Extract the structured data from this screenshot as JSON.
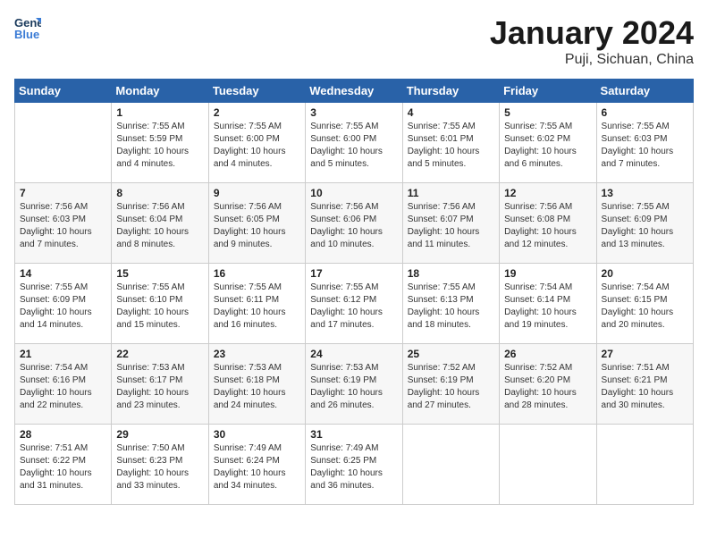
{
  "header": {
    "logo_line1": "General",
    "logo_line2": "Blue",
    "title": "January 2024",
    "subtitle": "Puji, Sichuan, China"
  },
  "days_of_week": [
    "Sunday",
    "Monday",
    "Tuesday",
    "Wednesday",
    "Thursday",
    "Friday",
    "Saturday"
  ],
  "weeks": [
    [
      {
        "day": "",
        "info": ""
      },
      {
        "day": "1",
        "info": "Sunrise: 7:55 AM\nSunset: 5:59 PM\nDaylight: 10 hours\nand 4 minutes."
      },
      {
        "day": "2",
        "info": "Sunrise: 7:55 AM\nSunset: 6:00 PM\nDaylight: 10 hours\nand 4 minutes."
      },
      {
        "day": "3",
        "info": "Sunrise: 7:55 AM\nSunset: 6:00 PM\nDaylight: 10 hours\nand 5 minutes."
      },
      {
        "day": "4",
        "info": "Sunrise: 7:55 AM\nSunset: 6:01 PM\nDaylight: 10 hours\nand 5 minutes."
      },
      {
        "day": "5",
        "info": "Sunrise: 7:55 AM\nSunset: 6:02 PM\nDaylight: 10 hours\nand 6 minutes."
      },
      {
        "day": "6",
        "info": "Sunrise: 7:55 AM\nSunset: 6:03 PM\nDaylight: 10 hours\nand 7 minutes."
      }
    ],
    [
      {
        "day": "7",
        "info": "Sunrise: 7:56 AM\nSunset: 6:03 PM\nDaylight: 10 hours\nand 7 minutes."
      },
      {
        "day": "8",
        "info": "Sunrise: 7:56 AM\nSunset: 6:04 PM\nDaylight: 10 hours\nand 8 minutes."
      },
      {
        "day": "9",
        "info": "Sunrise: 7:56 AM\nSunset: 6:05 PM\nDaylight: 10 hours\nand 9 minutes."
      },
      {
        "day": "10",
        "info": "Sunrise: 7:56 AM\nSunset: 6:06 PM\nDaylight: 10 hours\nand 10 minutes."
      },
      {
        "day": "11",
        "info": "Sunrise: 7:56 AM\nSunset: 6:07 PM\nDaylight: 10 hours\nand 11 minutes."
      },
      {
        "day": "12",
        "info": "Sunrise: 7:56 AM\nSunset: 6:08 PM\nDaylight: 10 hours\nand 12 minutes."
      },
      {
        "day": "13",
        "info": "Sunrise: 7:55 AM\nSunset: 6:09 PM\nDaylight: 10 hours\nand 13 minutes."
      }
    ],
    [
      {
        "day": "14",
        "info": "Sunrise: 7:55 AM\nSunset: 6:09 PM\nDaylight: 10 hours\nand 14 minutes."
      },
      {
        "day": "15",
        "info": "Sunrise: 7:55 AM\nSunset: 6:10 PM\nDaylight: 10 hours\nand 15 minutes."
      },
      {
        "day": "16",
        "info": "Sunrise: 7:55 AM\nSunset: 6:11 PM\nDaylight: 10 hours\nand 16 minutes."
      },
      {
        "day": "17",
        "info": "Sunrise: 7:55 AM\nSunset: 6:12 PM\nDaylight: 10 hours\nand 17 minutes."
      },
      {
        "day": "18",
        "info": "Sunrise: 7:55 AM\nSunset: 6:13 PM\nDaylight: 10 hours\nand 18 minutes."
      },
      {
        "day": "19",
        "info": "Sunrise: 7:54 AM\nSunset: 6:14 PM\nDaylight: 10 hours\nand 19 minutes."
      },
      {
        "day": "20",
        "info": "Sunrise: 7:54 AM\nSunset: 6:15 PM\nDaylight: 10 hours\nand 20 minutes."
      }
    ],
    [
      {
        "day": "21",
        "info": "Sunrise: 7:54 AM\nSunset: 6:16 PM\nDaylight: 10 hours\nand 22 minutes."
      },
      {
        "day": "22",
        "info": "Sunrise: 7:53 AM\nSunset: 6:17 PM\nDaylight: 10 hours\nand 23 minutes."
      },
      {
        "day": "23",
        "info": "Sunrise: 7:53 AM\nSunset: 6:18 PM\nDaylight: 10 hours\nand 24 minutes."
      },
      {
        "day": "24",
        "info": "Sunrise: 7:53 AM\nSunset: 6:19 PM\nDaylight: 10 hours\nand 26 minutes."
      },
      {
        "day": "25",
        "info": "Sunrise: 7:52 AM\nSunset: 6:19 PM\nDaylight: 10 hours\nand 27 minutes."
      },
      {
        "day": "26",
        "info": "Sunrise: 7:52 AM\nSunset: 6:20 PM\nDaylight: 10 hours\nand 28 minutes."
      },
      {
        "day": "27",
        "info": "Sunrise: 7:51 AM\nSunset: 6:21 PM\nDaylight: 10 hours\nand 30 minutes."
      }
    ],
    [
      {
        "day": "28",
        "info": "Sunrise: 7:51 AM\nSunset: 6:22 PM\nDaylight: 10 hours\nand 31 minutes."
      },
      {
        "day": "29",
        "info": "Sunrise: 7:50 AM\nSunset: 6:23 PM\nDaylight: 10 hours\nand 33 minutes."
      },
      {
        "day": "30",
        "info": "Sunrise: 7:49 AM\nSunset: 6:24 PM\nDaylight: 10 hours\nand 34 minutes."
      },
      {
        "day": "31",
        "info": "Sunrise: 7:49 AM\nSunset: 6:25 PM\nDaylight: 10 hours\nand 36 minutes."
      },
      {
        "day": "",
        "info": ""
      },
      {
        "day": "",
        "info": ""
      },
      {
        "day": "",
        "info": ""
      }
    ]
  ]
}
